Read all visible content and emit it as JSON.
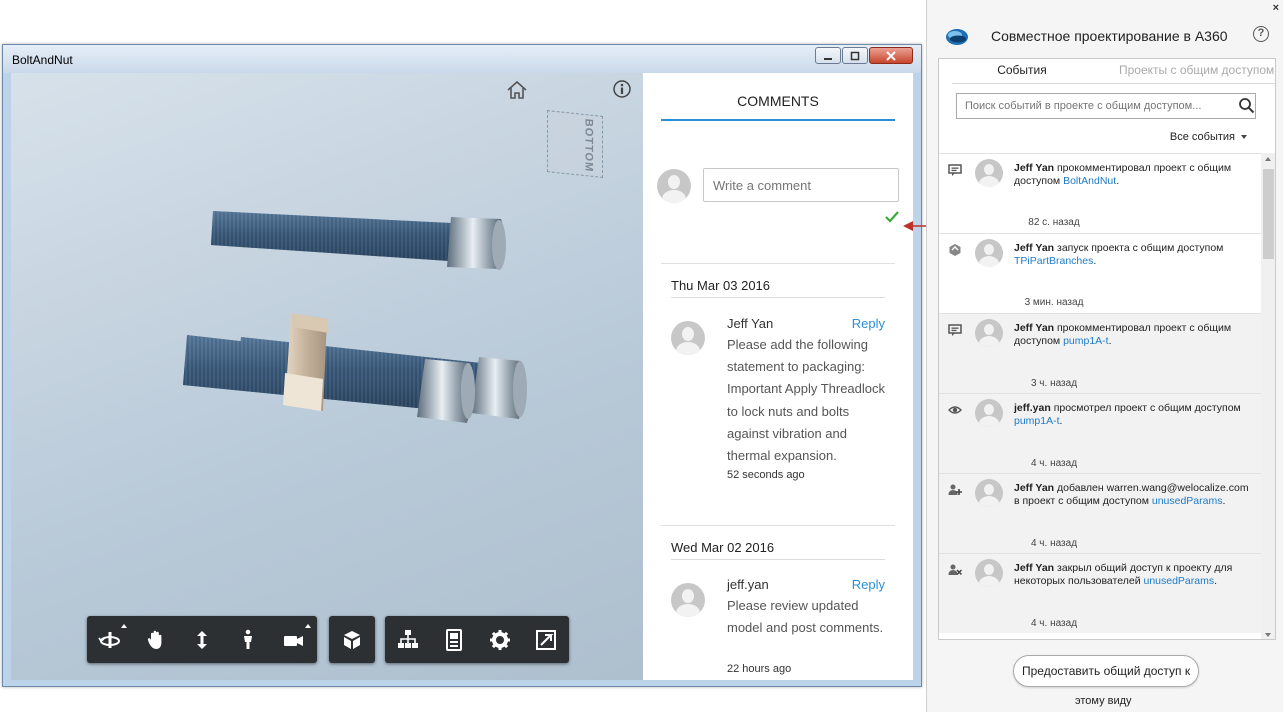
{
  "viewer": {
    "title": "BoltAndNut",
    "viewcube_label": "BOTTOM",
    "toolbar_icons": [
      "orbit-icon",
      "pan-icon",
      "zoom-icon",
      "walk-icon",
      "camera-icon",
      "cube-icon",
      "model-tree-icon",
      "properties-icon",
      "settings-icon",
      "fullscreen-icon"
    ]
  },
  "comments": {
    "heading": "COMMENTS",
    "input_placeholder": "Write a comment",
    "groups": [
      {
        "date": "Thu Mar 03 2016",
        "author": "Jeff Yan",
        "reply": "Reply",
        "text": "Please add the following statement to packaging: Important Apply Threadlock to lock nuts and bolts against vibration and thermal expansion.",
        "time": "52 seconds ago"
      },
      {
        "date": "Wed Mar 02 2016",
        "author": "jeff.yan",
        "reply": "Reply",
        "text": "Please review updated model and post comments.",
        "time": "22 hours ago"
      }
    ]
  },
  "a360": {
    "close": "×",
    "title": "Совместное проектирование в A360",
    "help": "?",
    "tabs": {
      "events": "События",
      "projects": "Проекты с общим доступом"
    },
    "search_placeholder": "Поиск событий в проекте с общим доступом...",
    "filter": "Все события",
    "events": [
      {
        "icon": "comment-icon",
        "user": "Jeff Yan",
        "action": "прокомментировал проект с общим доступом",
        "target": "BoltAndNut",
        "suffix": ".",
        "time": "82 с. назад"
      },
      {
        "icon": "launch-icon",
        "user": "Jeff Yan",
        "action": "запуск проекта с общим доступом",
        "target": "TPiPartBranches",
        "suffix": ".",
        "time": "3 мин. назад"
      },
      {
        "icon": "comment-icon",
        "user": "Jeff Yan",
        "action": "прокомментировал проект с общим доступом",
        "target": "pump1A-t",
        "suffix": ".",
        "time": "3 ч. назад"
      },
      {
        "icon": "view-icon",
        "user": "jeff.yan",
        "action": "просмотрел проект с общим доступом",
        "target": "pump1A-t",
        "suffix": ".",
        "time": "4 ч. назад"
      },
      {
        "icon": "add-user-icon",
        "user": "Jeff Yan",
        "action": "добавлен warren.wang@welocalize.com в проект с общим доступом",
        "target": "unusedParams",
        "suffix": ".",
        "time": "4 ч. назад"
      },
      {
        "icon": "remove-user-icon",
        "user": "Jeff Yan",
        "action": "закрыл общий доступ к проекту для некоторых пользователей",
        "target": "unusedParams",
        "suffix": ".",
        "time": "4 ч. назад"
      }
    ],
    "share_button": "Предоставить общий доступ к",
    "share_button_line2": "этому виду"
  },
  "colors": {
    "accent": "#2b8fd6",
    "link": "#1e7bc8",
    "toolbar": "#2d3033",
    "check": "#3aa83a",
    "arrow": "#c0302a"
  }
}
